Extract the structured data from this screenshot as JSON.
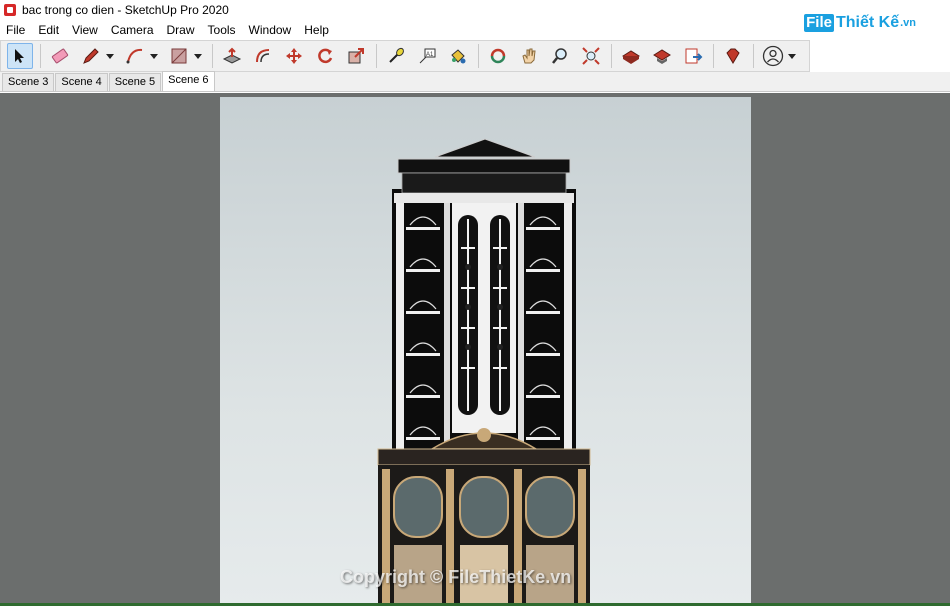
{
  "window": {
    "title": "bac trong co dien - SketchUp Pro 2020"
  },
  "watermark": {
    "brand_box": "File",
    "brand_text": "Thiết Kế",
    "brand_suffix": ".vn",
    "copyright": "Copyright © FileThietKe.vn"
  },
  "menu": [
    "File",
    "Edit",
    "View",
    "Camera",
    "Draw",
    "Tools",
    "Window",
    "Help"
  ],
  "scenes": {
    "tabs": [
      "Scene 3",
      "Scene 4",
      "Scene 5",
      "Scene 6"
    ],
    "selected": "Scene 6"
  },
  "toolbar": {
    "tools": [
      "select-icon",
      "eraser-icon",
      "pencil-icon",
      "arc-icon",
      "rectangle-icon",
      "push-pull-icon",
      "offset-icon",
      "move-icon",
      "rotate-icon",
      "scale-icon",
      "tape-measure-icon",
      "text-icon",
      "paint-bucket-icon",
      "orbit-icon",
      "pan-icon",
      "zoom-icon",
      "zoom-extents-icon",
      "warehouse-icon",
      "extension-warehouse-icon",
      "send-to-layout-icon",
      "ruby-console-icon",
      "account-icon"
    ]
  }
}
